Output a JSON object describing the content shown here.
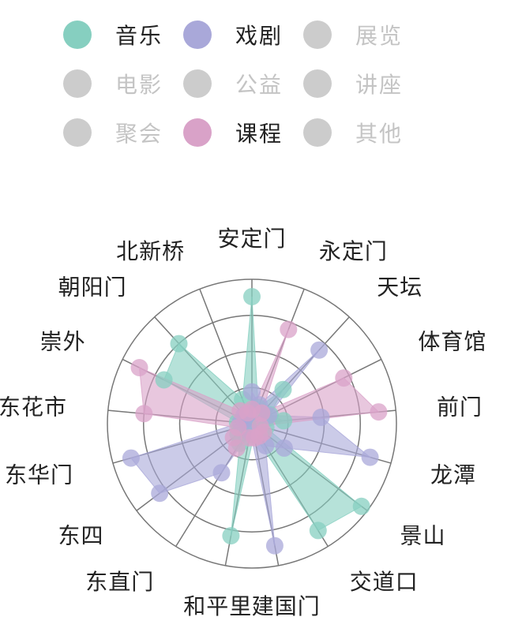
{
  "legend": {
    "items": [
      {
        "label": "音乐",
        "color": "#86cfc0",
        "active": true
      },
      {
        "label": "戏剧",
        "color": "#a9a8d9",
        "active": true
      },
      {
        "label": "展览",
        "color": "#cccccc",
        "active": false
      },
      {
        "label": "电影",
        "color": "#cccccc",
        "active": false
      },
      {
        "label": "公益",
        "color": "#cccccc",
        "active": false
      },
      {
        "label": "讲座",
        "color": "#cccccc",
        "active": false
      },
      {
        "label": "聚会",
        "color": "#cccccc",
        "active": false
      },
      {
        "label": "课程",
        "color": "#d9a2c8",
        "active": true
      },
      {
        "label": "其他",
        "color": "#cccccc",
        "active": false
      }
    ],
    "active_text_color": "#222222",
    "inactive_text_color": "#c4c4c4"
  },
  "chart_data": {
    "type": "radar",
    "categories": [
      "安定门",
      "永定门",
      "天坛",
      "体育馆",
      "前门",
      "龙潭",
      "景山",
      "交道口",
      "建国门",
      "和平里",
      "东直门",
      "东四",
      "东华门",
      "东花市",
      "崇外",
      "朝阳门",
      "北新桥"
    ],
    "rlim": [
      0,
      100
    ],
    "rings": 4,
    "grid": true,
    "series": [
      {
        "name": "音乐",
        "color": "#86cfc0",
        "values": [
          88,
          12,
          32,
          14,
          22,
          10,
          95,
          87,
          8,
          79,
          16,
          12,
          3,
          10,
          68,
          75,
          18
        ]
      },
      {
        "name": "戏剧",
        "color": "#a9a8d9",
        "values": [
          22,
          14,
          69,
          13,
          48,
          85,
          28,
          18,
          86,
          6,
          40,
          80,
          87,
          8,
          6,
          8,
          7
        ]
      },
      {
        "name": "课程",
        "color": "#d9a2c8",
        "values": [
          10,
          70,
          10,
          71,
          88,
          6,
          10,
          10,
          10,
          10,
          20,
          16,
          10,
          75,
          87,
          12,
          8
        ]
      }
    ]
  }
}
